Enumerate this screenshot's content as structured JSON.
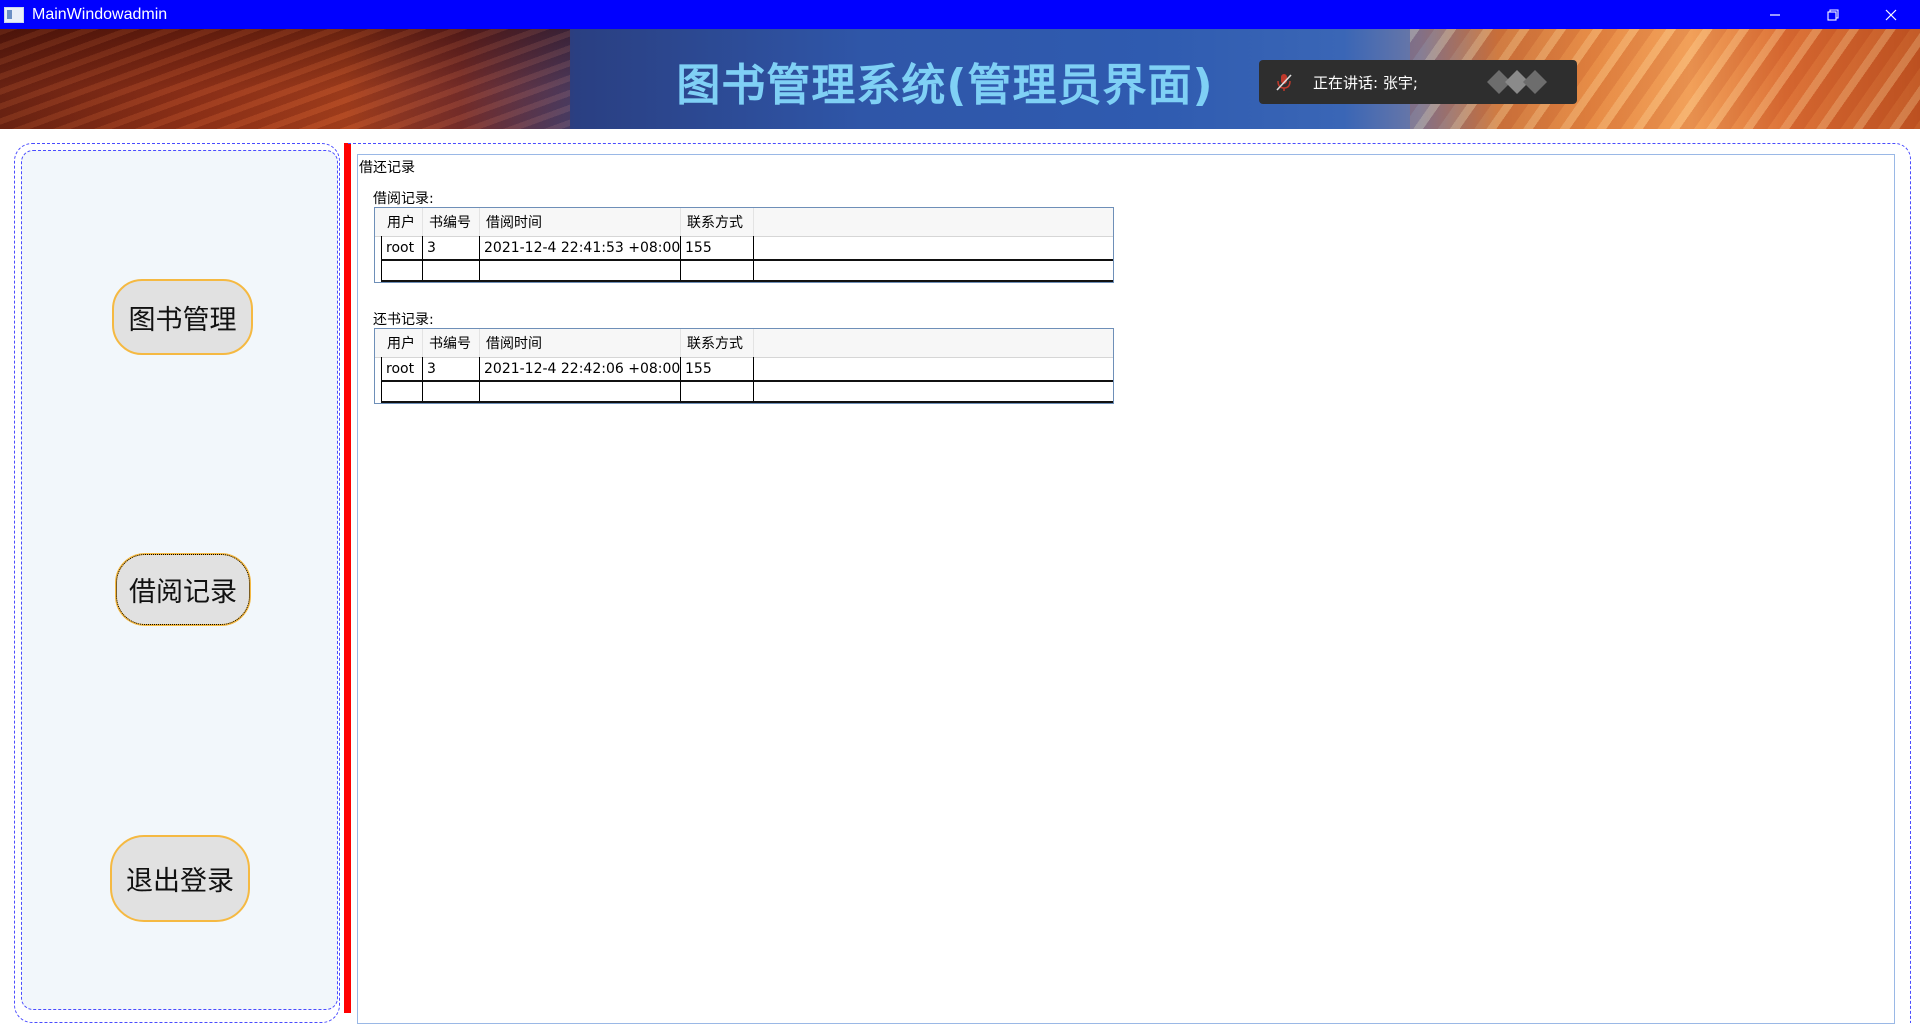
{
  "window": {
    "title": "MainWindowadmin",
    "controls": {
      "minimize": "—",
      "restore": "❐",
      "close": "✕"
    }
  },
  "banner": {
    "title": "图书管理系统(管理员界面)"
  },
  "toast": {
    "text": "正在讲话: 张宇;"
  },
  "nav": {
    "buttons": [
      {
        "label": "图书管理"
      },
      {
        "label": "借阅记录"
      },
      {
        "label": "退出登录"
      }
    ]
  },
  "content": {
    "section_title": "借还记录",
    "borrow": {
      "caption": "借阅记录:",
      "columns": [
        "用户",
        "书编号",
        "借阅时间",
        "联系方式"
      ],
      "rows": [
        [
          "root",
          "3",
          "2021-12-4 22:41:53 +08:00",
          "155"
        ]
      ]
    },
    "return": {
      "caption": "还书记录:",
      "columns": [
        "用户",
        "书编号",
        "借阅时间",
        "联系方式"
      ],
      "rows": [
        [
          "root",
          "3",
          "2021-12-4 22:42:06 +08:00",
          "155"
        ]
      ]
    }
  },
  "colors": {
    "titlebar": "#0000ff",
    "banner_title": "#7fd0f5",
    "divider": "#ff0000",
    "nav_button_border": "#f5b942",
    "nav_panel_bg": "#f2f7fb"
  }
}
